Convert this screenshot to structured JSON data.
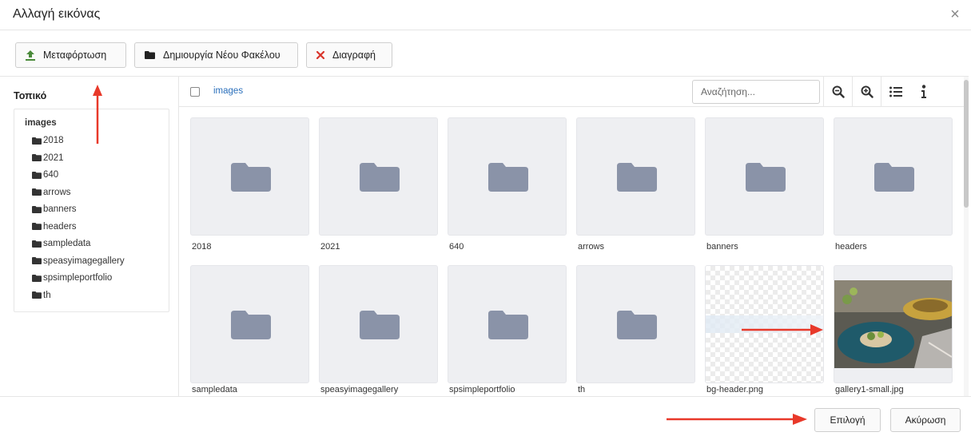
{
  "window": {
    "title": "Αλλαγή εικόνας",
    "close_glyph": "×"
  },
  "toolbar": {
    "upload_label": "Μεταφόρτωση",
    "new_folder_label": "Δημιουργία Νέου Φακέλου",
    "delete_label": "Διαγραφή"
  },
  "sidebar": {
    "title": "Τοπικό",
    "root": "images",
    "items": [
      "2018",
      "2021",
      "640",
      "arrows",
      "banners",
      "headers",
      "sampledata",
      "speasyimagegallery",
      "spsimpleportfolio",
      "th"
    ]
  },
  "main": {
    "breadcrumb": "images",
    "search_placeholder": "Αναζήτηση...",
    "tiles": [
      {
        "label": "2018",
        "kind": "folder"
      },
      {
        "label": "2021",
        "kind": "folder"
      },
      {
        "label": "640",
        "kind": "folder"
      },
      {
        "label": "arrows",
        "kind": "folder"
      },
      {
        "label": "banners",
        "kind": "folder"
      },
      {
        "label": "headers",
        "kind": "folder"
      },
      {
        "label": "sampledata",
        "kind": "folder"
      },
      {
        "label": "speasyimagegallery",
        "kind": "folder"
      },
      {
        "label": "spsimpleportfolio",
        "kind": "folder"
      },
      {
        "label": "th",
        "kind": "folder"
      },
      {
        "label": "bg-header.png",
        "kind": "image-transparent"
      },
      {
        "label": "gallery1-small.jpg",
        "kind": "image-photo"
      }
    ]
  },
  "footer": {
    "select_label": "Επιλογή",
    "cancel_label": "Ακύρωση"
  },
  "colors": {
    "folder": "#8a93a8",
    "link": "#2a6fbb",
    "annotation_arrow": "#e8392a",
    "delete_x": "#d9352b",
    "upload_icon": "#4a8a3a"
  },
  "icons": [
    "upload-icon",
    "folder-icon",
    "delete-x-icon",
    "zoom-out-icon",
    "zoom-in-icon",
    "list-view-icon",
    "info-icon",
    "close-icon"
  ]
}
